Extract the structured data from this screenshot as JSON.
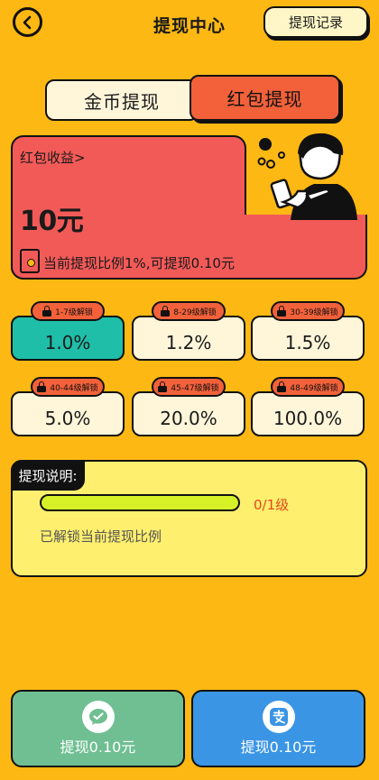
{
  "header": {
    "title": "提现中心",
    "record_label": "提现记录",
    "back_icon": "back-arrow-icon"
  },
  "tabs": [
    {
      "label": "金币提现",
      "selected": false
    },
    {
      "label": "红包提现",
      "selected": true
    }
  ],
  "earnings": {
    "title": "红包收益>",
    "amount": "10元",
    "ratio_text": "当前提现比例1%,可提现0.10元",
    "icon": "red-envelope-icon"
  },
  "levels": [
    {
      "tag": "1-7级解锁",
      "ratio": "1.0%",
      "active": true
    },
    {
      "tag": "8-29级解锁",
      "ratio": "1.2%",
      "active": false
    },
    {
      "tag": "30-39级解锁",
      "ratio": "1.5%",
      "active": false
    },
    {
      "tag": "40-44级解锁",
      "ratio": "5.0%",
      "active": false
    },
    {
      "tag": "45-47级解锁",
      "ratio": "20.0%",
      "active": false
    },
    {
      "tag": "48-49级解锁",
      "ratio": "100.0%",
      "active": false
    }
  ],
  "explain": {
    "label": "提现说明:",
    "progress_text": "0/1级",
    "progress_fraction": 0,
    "unlock_text": "已解锁当前提现比例"
  },
  "pay_buttons": [
    {
      "label": "提现0.10元",
      "icon": "wechat-pay-icon"
    },
    {
      "label": "提现0.10元",
      "icon": "alipay-icon"
    }
  ],
  "colors": {
    "background": "#FDB813",
    "card_red": "#F25A58",
    "tab_active": "#F2613A",
    "level_active": "#1FBEA8",
    "wechat_green": "#6FBF92",
    "alipay_blue": "#3A95E4",
    "progress_green": "#D6F227"
  }
}
